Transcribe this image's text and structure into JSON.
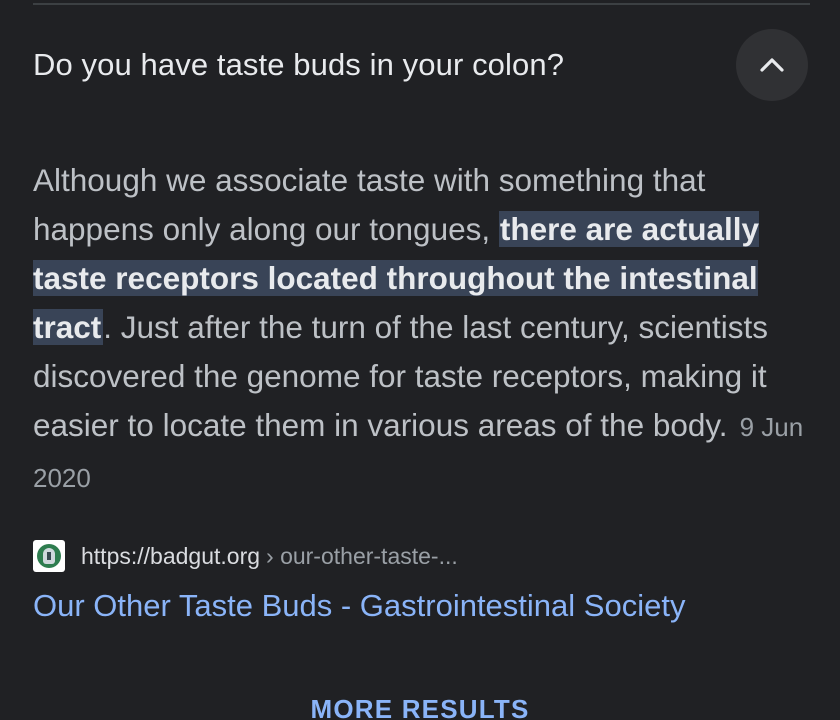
{
  "question": {
    "text": "Do you have taste buds in your colon?",
    "collapse_icon": "chevron-up-icon"
  },
  "answer": {
    "before_highlight": "Although we associate taste with something that happens only along our tongues, ",
    "highlight": "there are actually taste receptors located throughout the intestinal tract",
    "after_highlight": ". Just after the turn of the last century, scientists discovered the genome for taste receptors, making it easier to locate them in various areas of the body.",
    "date": "9 Jun 2020"
  },
  "source": {
    "favicon": "badgut-favicon-icon",
    "domain": "https://badgut.org",
    "path": "› our-other-taste-...",
    "title": "Our Other Taste Buds - Gastrointestinal Society"
  },
  "footer": {
    "more_results_label": "MORE RESULTS"
  },
  "colors": {
    "background": "#202124",
    "text_primary": "#e8eaed",
    "text_secondary": "#bdc1c6",
    "link": "#8ab4f8",
    "highlight_bg": "#394457"
  }
}
